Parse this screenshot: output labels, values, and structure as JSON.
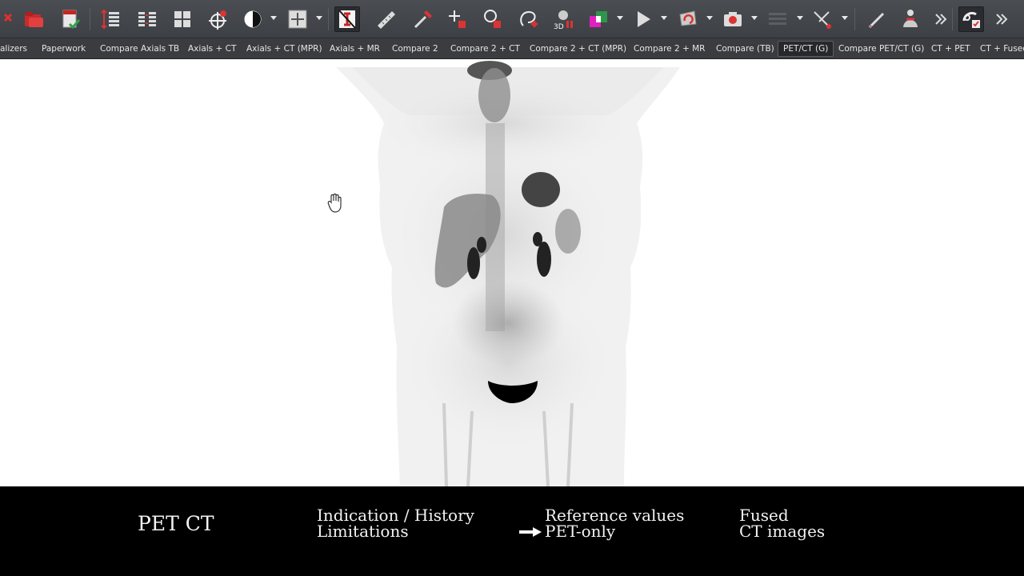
{
  "toolbar": {
    "tools": [
      {
        "name": "close-study-icon"
      },
      {
        "name": "open-folder-icon"
      },
      {
        "name": "report-icon"
      },
      {
        "name": "stack-scroll-icon"
      },
      {
        "name": "sync-stack-icon"
      },
      {
        "name": "layout-grid-icon"
      },
      {
        "name": "crosshair-icon"
      },
      {
        "name": "window-level-icon"
      },
      {
        "name": "pan-zoom-icon"
      },
      {
        "name": "invert-icon"
      },
      {
        "name": "ruler-icon"
      },
      {
        "name": "probe-icon"
      },
      {
        "name": "point-icon"
      },
      {
        "name": "roi-icon"
      },
      {
        "name": "lasso-icon"
      },
      {
        "name": "3d-icon"
      },
      {
        "name": "fusion-icon"
      },
      {
        "name": "cine-play-icon"
      },
      {
        "name": "rotate-icon"
      },
      {
        "name": "snapshot-icon"
      },
      {
        "name": "mip-icon"
      },
      {
        "name": "cut-icon"
      },
      {
        "name": "annotate-pen-icon"
      },
      {
        "name": "anatomy-icon"
      },
      {
        "name": "more-tools-icon"
      },
      {
        "name": "workflow-icon"
      }
    ],
    "badge_3d": "3D"
  },
  "tabs": [
    {
      "label": "alizers"
    },
    {
      "label": "Paperwork"
    },
    {
      "label": "Compare Axials TB"
    },
    {
      "label": "Axials + CT"
    },
    {
      "label": "Axials + CT (MPR)"
    },
    {
      "label": "Axials + MR"
    },
    {
      "label": "Compare 2"
    },
    {
      "label": "Compare 2 + CT"
    },
    {
      "label": "Compare 2 + CT (MPR)"
    },
    {
      "label": "Compare 2 + MR"
    },
    {
      "label": "Compare (TB)"
    },
    {
      "label": "PET/CT (G)",
      "selected": true
    },
    {
      "label": "Compare PET/CT (G)"
    },
    {
      "label": "CT + PET"
    },
    {
      "label": "CT + Fusec"
    }
  ],
  "footer": {
    "title": "PET CT",
    "col1": [
      "Indication / History",
      "Limitations"
    ],
    "col2": [
      "Reference values",
      "PET-only"
    ],
    "col3": [
      "Fused",
      "CT images"
    ]
  },
  "colors": {
    "toolbar": "#43464b",
    "viewer_bg": "#ffffff",
    "footer_bg": "#000000",
    "accent_red": "#d22a2a"
  }
}
